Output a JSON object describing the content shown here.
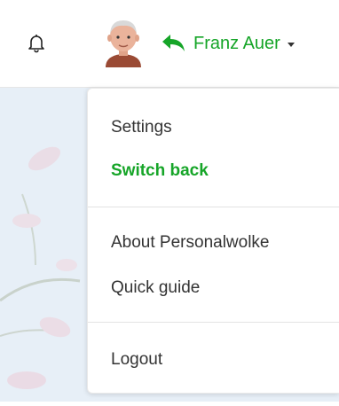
{
  "header": {
    "notifications_icon": "bell-icon",
    "avatar_icon": "user-avatar",
    "switch_back_icon": "return-arrow-icon",
    "user_name": "Franz Auer",
    "accent_color": "#16a528"
  },
  "menu": {
    "settings": "Settings",
    "switch_back": "Switch back",
    "about": "About Personalwolke",
    "quick_guide": "Quick guide",
    "logout": "Logout"
  }
}
